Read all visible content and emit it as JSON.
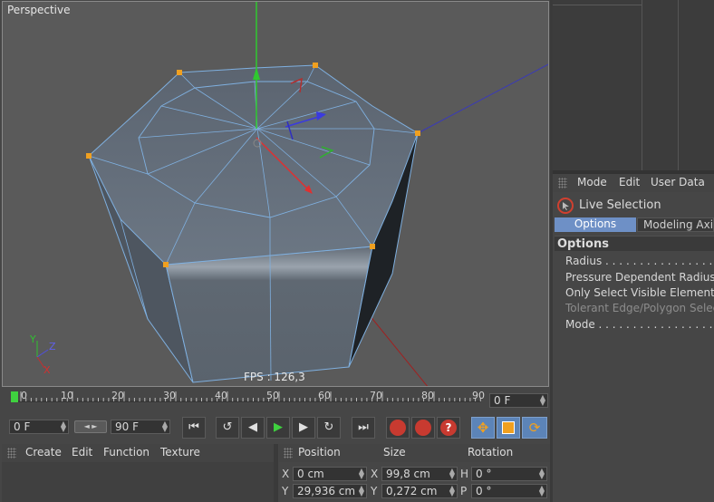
{
  "viewport": {
    "title": "Perspective",
    "fps": "FPS : 126,3"
  },
  "attributes": {
    "menu": [
      "Mode",
      "Edit",
      "User Data"
    ],
    "tool_name": "Live Selection",
    "tabs": [
      "Options",
      "Modeling Axis"
    ],
    "section": "Options",
    "options": [
      {
        "label": "Radius . . . . . . . . . . . . . . . . . . .",
        "enabled": true
      },
      {
        "label": "Pressure Dependent Radius",
        "enabled": true
      },
      {
        "label": "Only Select Visible Elements",
        "enabled": true
      },
      {
        "label": "Tolerant Edge/Polygon Selection",
        "enabled": false
      },
      {
        "label": "Mode . . . . . . . . . . . . . . . . . . . . .",
        "enabled": true
      }
    ]
  },
  "timeline": {
    "ticks": [
      "0",
      "10",
      "20",
      "30",
      "40",
      "50",
      "60",
      "70",
      "80",
      "90"
    ],
    "current_frame": "0 F",
    "start_frame": "0 F",
    "end_frame": "90 F"
  },
  "materials": {
    "menu": [
      "Create",
      "Edit",
      "Function",
      "Texture"
    ]
  },
  "coordinates": {
    "headers": [
      "Position",
      "Size",
      "Rotation"
    ],
    "rows": [
      {
        "pos_axis": "X",
        "pos": "0 cm",
        "size_axis": "X",
        "size": "99,8 cm",
        "rot_axis": "H",
        "rot": "0 °"
      },
      {
        "pos_axis": "Y",
        "pos": "29,936 cm",
        "size_axis": "Y",
        "size": "0,272 cm",
        "rot_axis": "P",
        "rot": "0 °"
      }
    ]
  },
  "colors": {
    "accent_blue": "#6d8fc4",
    "active_tab": "#6e90c6",
    "play_green": "#3fd13f"
  }
}
